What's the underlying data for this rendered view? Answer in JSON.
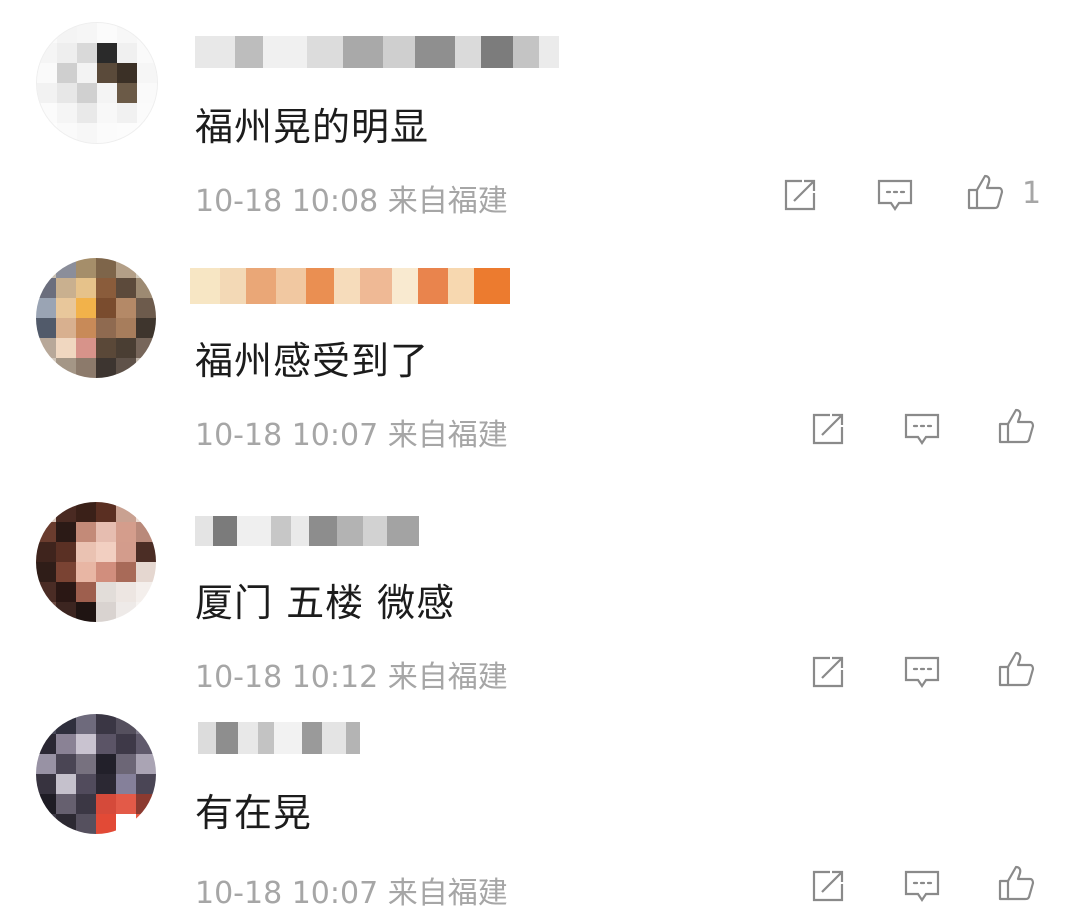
{
  "comments": [
    {
      "text": "福州晃的明显",
      "meta_time": "10-18 10:08",
      "meta_source": "来自福建",
      "like_count": "1"
    },
    {
      "text": "福州感受到了",
      "meta_time": "10-18 10:07",
      "meta_source": "来自福建",
      "like_count": ""
    },
    {
      "text": "厦门 五楼 微感",
      "meta_time": "10-18 10:12",
      "meta_source": "来自福建",
      "like_count": ""
    },
    {
      "text": "有在晃",
      "meta_time": "10-18 10:07",
      "meta_source": "来自福建",
      "like_count": ""
    }
  ],
  "icons": {
    "share": "share-icon",
    "reply": "comment-icon",
    "like": "thumbs-up-icon"
  },
  "colors": {
    "text": "#1c1c1c",
    "meta": "#a6a6a6",
    "icon": "#8a8a8a"
  }
}
